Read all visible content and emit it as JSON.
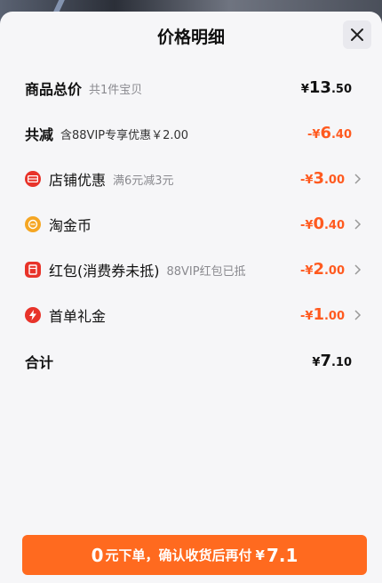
{
  "sheet": {
    "title": "价格明细"
  },
  "rows": {
    "total": {
      "label": "商品总价",
      "sub": "共1件宝贝",
      "currency": "¥",
      "int": "13",
      "dec": ".50"
    },
    "discount": {
      "label": "共减",
      "sub": "含88VIP专享优惠￥2.00",
      "currency": "-¥",
      "int": "6",
      "dec": ".40"
    },
    "shop": {
      "label": "店铺优惠",
      "sub": "满6元减3元",
      "currency": "-¥",
      "int": "3",
      "dec": ".00"
    },
    "coins": {
      "label": "淘金币",
      "currency": "-¥",
      "int": "0",
      "dec": ".40"
    },
    "redpacket": {
      "label": "红包(消费券未抵)",
      "sub": "88VIP红包已抵",
      "currency": "-¥",
      "int": "2",
      "dec": ".00"
    },
    "firstorder": {
      "label": "首单礼金",
      "currency": "-¥",
      "int": "1",
      "dec": ".00"
    },
    "sum": {
      "label": "合计",
      "currency": "¥",
      "int": "7",
      "dec": ".10"
    }
  },
  "cta": {
    "big": "0",
    "text": "元下单，确认收货后再付",
    "currency": "¥",
    "amount": "7.1"
  },
  "colors": {
    "accent": "#ff5a1f",
    "button": "#ff6a1f",
    "badge_red": "#e8332a",
    "badge_gold": "#f5a623"
  },
  "icons": [
    "close-icon",
    "shop-coupon-icon",
    "coin-icon",
    "red-packet-icon",
    "lightning-icon",
    "chevron-right-icon"
  ]
}
